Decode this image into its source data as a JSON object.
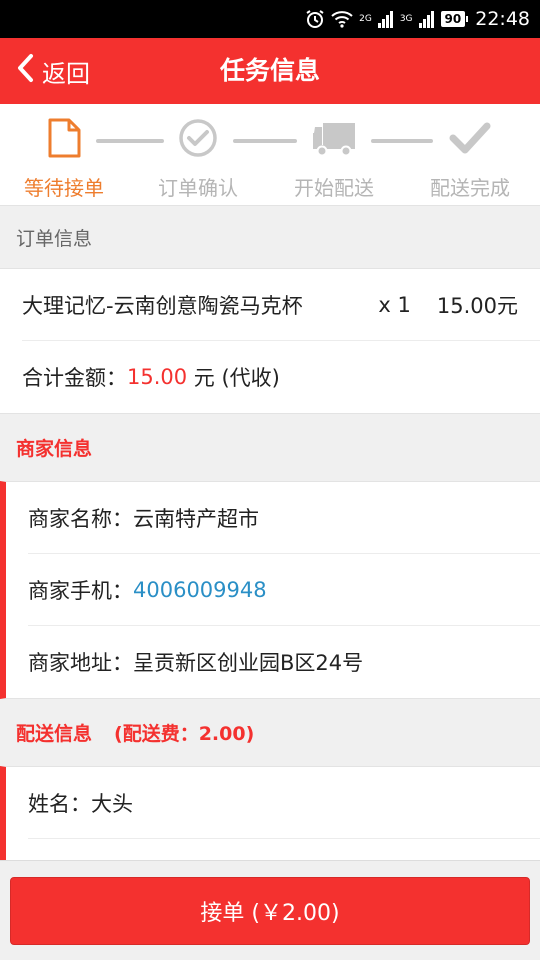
{
  "status_bar": {
    "network_1": "2G",
    "network_2": "3G",
    "battery": "90",
    "time": "22:48"
  },
  "header": {
    "back_label": "返回",
    "title": "任务信息"
  },
  "steps": [
    {
      "label": "等待接单",
      "icon": "document-icon",
      "state": "active"
    },
    {
      "label": "订单确认",
      "icon": "check-circle-icon",
      "state": "pending"
    },
    {
      "label": "开始配送",
      "icon": "truck-icon",
      "state": "pending"
    },
    {
      "label": "配送完成",
      "icon": "checkmark-icon",
      "state": "pending"
    }
  ],
  "order": {
    "section_title": "订单信息",
    "item": {
      "name": "大理记忆-云南创意陶瓷马克杯",
      "qty": "x 1",
      "price": "15.00元"
    },
    "total_label": "合计金额：",
    "total_amount": "15.00",
    "total_suffix": " 元 (代收)"
  },
  "merchant": {
    "section_title": "商家信息",
    "name_label": "商家名称：",
    "name": "云南特产超市",
    "phone_label": "商家手机：",
    "phone": "4006009948",
    "address_label": "商家地址：",
    "address": "呈贡新区创业园B区24号"
  },
  "delivery": {
    "section_title": "配送信息",
    "fee_note": "(配送费：2.00)",
    "customer_label": "姓名：",
    "customer_name": "大头"
  },
  "action": {
    "accept_label": "接单 (￥2.00)"
  },
  "colors": {
    "brand_red": "#f4312f",
    "active_orange": "#ee7d2e",
    "inactive_gray": "#c8c8c8",
    "link_blue": "#2a8fc6"
  }
}
